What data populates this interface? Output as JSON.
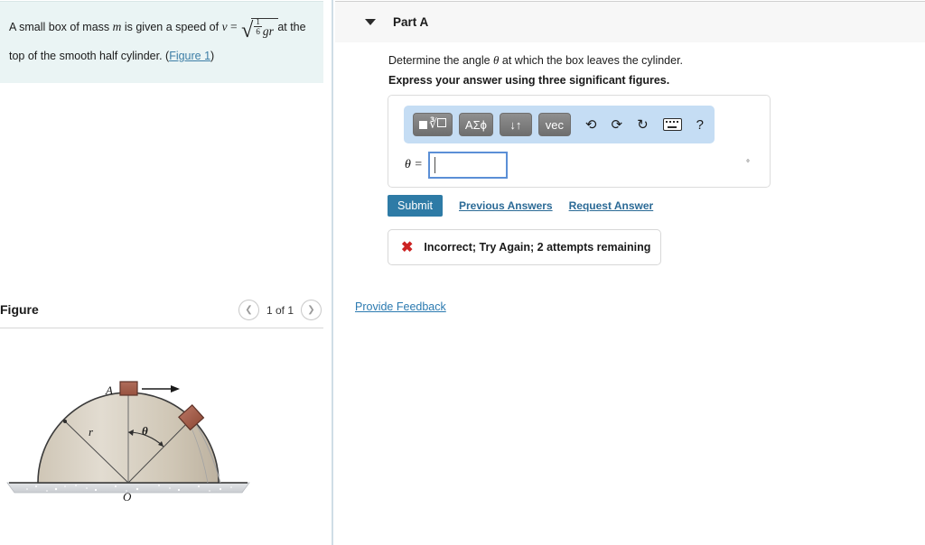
{
  "question": {
    "line1_pre": "A small box of mass ",
    "mass_symbol": "m",
    "line1_mid": " is given a speed of ",
    "speed_symbol": "v",
    "equals": "=",
    "frac_num": "1",
    "frac_den": "6",
    "radicand_tail": "gr",
    "line1_post": " at the",
    "line2_pre": "top of the smooth half cylinder. (",
    "figure_link": "Figure 1",
    "line2_post": ")"
  },
  "figure": {
    "title": "Figure",
    "pager_label": "1 of 1",
    "prev_icon": "chevron-left-icon",
    "next_icon": "chevron-right-icon",
    "labels": {
      "box_top": "A",
      "radius": "r",
      "angle": "θ",
      "center": "O"
    },
    "colors": {
      "cylinder_fill_light": "#ded7ca",
      "cylinder_fill_dark": "#c9bfae",
      "cylinder_stroke": "#3a3a3a",
      "box_fill": "#a9604f",
      "box_stroke": "#5e3328",
      "ground_fill": "#d8dadd",
      "trajectory": "#9a9a9a"
    }
  },
  "part": {
    "caret_icon": "caret-down-icon",
    "title": "Part A",
    "prompt_pre": "Determine the angle ",
    "prompt_symbol": "θ",
    "prompt_post": " at which the box leaves the cylinder.",
    "sigfig_note": "Express your answer using three significant figures."
  },
  "math_toolbar": {
    "template_button": "template-root-button",
    "greek_button": "ΑΣϕ",
    "arrows_button": "↓↑",
    "vector_button": "vec",
    "undo_icon": "undo-arrow-icon",
    "redo_icon": "redo-arrow-icon",
    "reset_icon": "refresh-icon",
    "keyboard_icon": "keyboard-icon",
    "help_label": "?",
    "background_color": "#c5ddf4"
  },
  "answer": {
    "variable_label": "θ =",
    "value": "",
    "placeholder": "",
    "unit": "°",
    "focus_color": "#5b8fd6"
  },
  "actions": {
    "submit_label": "Submit",
    "submit_color": "#2e7ba6",
    "previous_answers_label": "Previous Answers",
    "request_answer_label": "Request Answer"
  },
  "feedback_box": {
    "icon": "x-mark-icon",
    "icon_color": "#cc2222",
    "message": "Incorrect; Try Again; 2 attempts remaining"
  },
  "footer": {
    "provide_feedback_label": "Provide Feedback",
    "link_color": "#2b7ab0"
  }
}
